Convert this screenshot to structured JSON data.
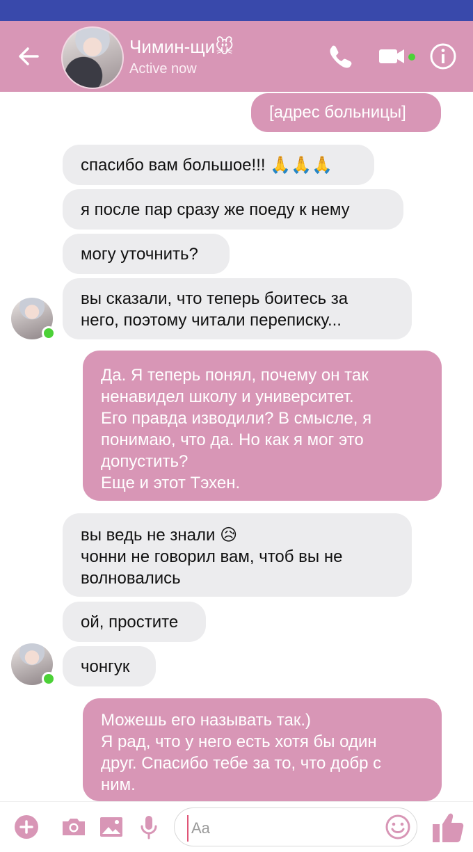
{
  "header": {
    "contact_name": "Чимин-щи🐭",
    "status": "Active now",
    "icons": [
      "back-arrow-icon",
      "phone-icon",
      "video-camera-icon",
      "info-icon"
    ]
  },
  "messages": [
    {
      "side": "out",
      "text": "[адрес больницы]"
    },
    {
      "side": "in",
      "text": "спасибо вам большое!!! 🙏🙏🙏"
    },
    {
      "side": "in",
      "text": "я после пар сразу же поеду к нему"
    },
    {
      "side": "in",
      "text": "могу уточнить?"
    },
    {
      "side": "in",
      "text": "вы сказали, что теперь боитесь за\nнего, поэтому читали переписку..."
    },
    {
      "side": "out",
      "text": "Да. Я теперь понял, почему он так\nненавидел школу и университет.\nЕго правда изводили? В смысле, я\nпонимаю, что да. Но как я мог это\nдопустить?\nЕще и этот Тэхен."
    },
    {
      "side": "in",
      "text": "вы ведь не знали 😥\nчонни не говорил вам, чтоб вы не\nволновались"
    },
    {
      "side": "in",
      "text": "ой, простите"
    },
    {
      "side": "in",
      "text": "чонгук"
    },
    {
      "side": "out",
      "text": "Можешь его называть так.)\nЯ рад, что у него есть хотя бы один\nдруг. Спасибо тебе за то, что добр с\nним."
    }
  ],
  "composer": {
    "placeholder": "Aa",
    "icons": [
      "plus-icon",
      "camera-icon",
      "gallery-icon",
      "microphone-icon",
      "emoji-icon",
      "thumbs-up-icon"
    ]
  },
  "colors": {
    "accent": "#d896b6",
    "status_bar": "#3949ab",
    "incoming_bubble": "#ececee",
    "online": "#4cd137"
  }
}
